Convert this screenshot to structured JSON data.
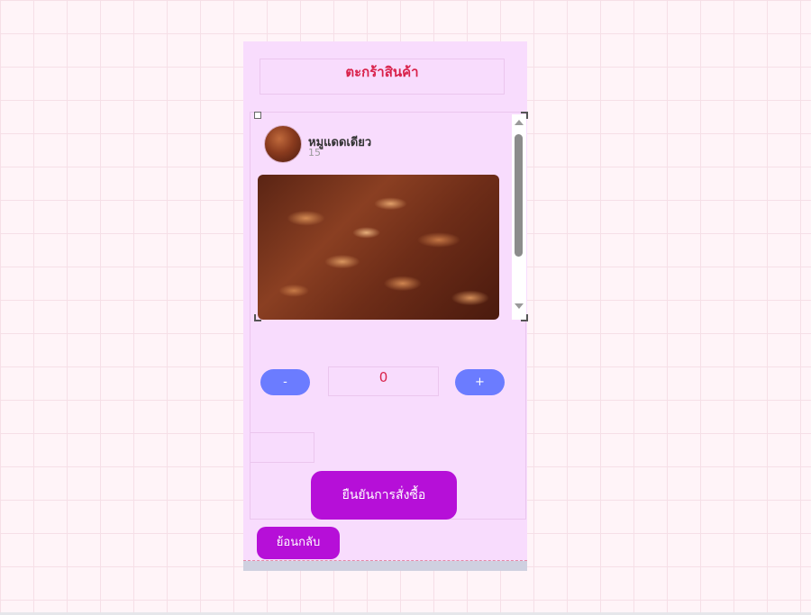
{
  "header": {
    "title": "ตะกร้าสินค้า"
  },
  "item": {
    "name": "หมูแดดเดียว",
    "sub_value": "15"
  },
  "quantity": {
    "minus_label": "-",
    "value": "0",
    "plus_label": "+"
  },
  "actions": {
    "confirm_label": "ยืนยันการสั่งซื้อ",
    "back_label": "ย้อนกลับ"
  },
  "colors": {
    "page_bg": "#fff4f8",
    "phone_bg": "#f8dcfd",
    "title_text": "#d9224b",
    "qty_button": "#6b7cff",
    "primary_button": "#b60fd8"
  },
  "icons": {
    "scroll_up": "scroll-up-arrow-icon",
    "scroll_down": "scroll-down-arrow-icon",
    "avatar": "food-thumbnail",
    "photo": "dried-pork-photo"
  }
}
